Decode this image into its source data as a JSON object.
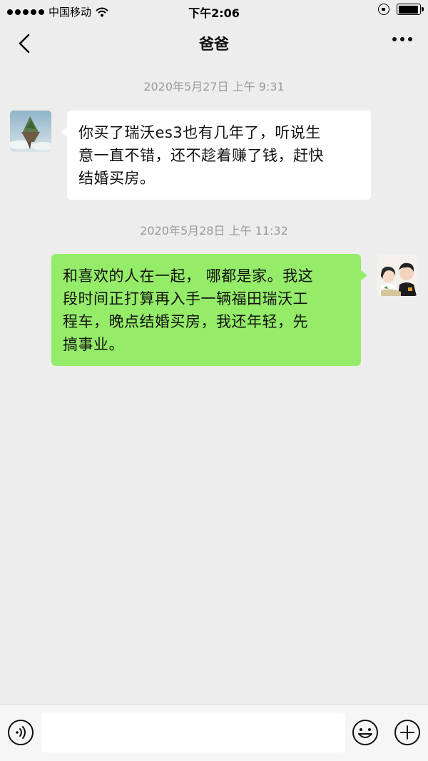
{
  "status_bar": {
    "carrier": "中国移动",
    "time": "下午2:06",
    "battery_level": 0.95
  },
  "nav": {
    "title": "爸爸"
  },
  "messages": [
    {
      "timestamp": "2020年5月27日 上午 9:31",
      "sender": "other",
      "lines": [
        "你买了瑞沃es3也有几年了，听说生",
        "意一直不错，还不趁着赚了钱，赶快",
        "结婚买房。"
      ]
    },
    {
      "timestamp": "2020年5月28日 上午 11:32",
      "sender": "me",
      "lines": [
        "和喜欢的人在一起， 哪都是家。我这",
        "段时间正打算再入手一辆福田瑞沃工",
        "程车，晚点结婚买房，我还年轻，先",
        "搞事业。"
      ]
    }
  ],
  "input_bar": {
    "text_value": "",
    "icons": [
      "voice-icon",
      "emoji-icon",
      "plus-icon"
    ]
  },
  "colors": {
    "background": "#ededed",
    "bubble_me": "#95ec69",
    "bubble_other": "#ffffff",
    "timestamp": "#9a9a9a"
  }
}
